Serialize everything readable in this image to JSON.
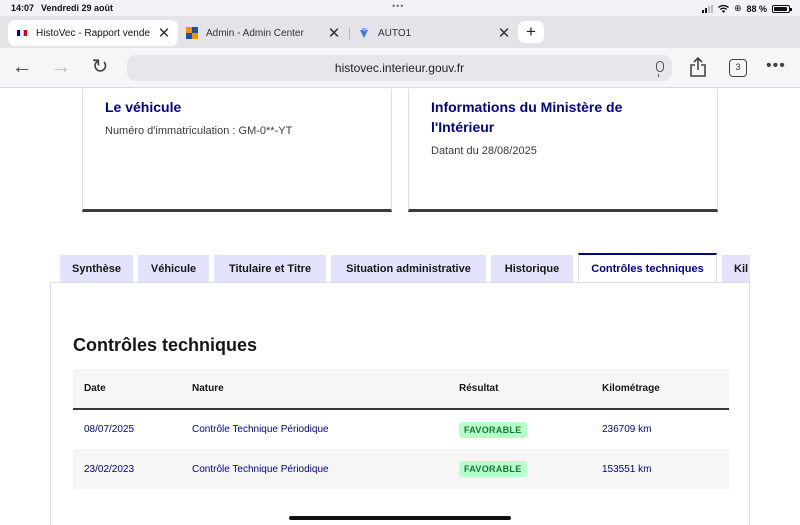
{
  "status_bar": {
    "time": "14:07",
    "date": "Vendredi 29 août",
    "battery": "88 %"
  },
  "browser": {
    "tabs": [
      {
        "title": "HistoVec - Rapport vende",
        "active": true
      },
      {
        "title": "Admin - Admin Center",
        "active": false
      },
      {
        "title": "AUTO1",
        "active": false
      }
    ],
    "url": "histovec.interieur.gouv.fr",
    "tab_count": "3"
  },
  "cards": {
    "vehicle": {
      "title": "Le véhicule",
      "text": "Numéro d'immatriculation : GM-0**-YT"
    },
    "ministry": {
      "title_line1": "Informations du Ministère de",
      "title_line2": "l'Intérieur",
      "text": "Datant du 28/08/2025"
    }
  },
  "nav_tabs": [
    "Synthèse",
    "Véhicule",
    "Titulaire et Titre",
    "Situation administrative",
    "Historique",
    "Contrôles techniques",
    "Kil"
  ],
  "section": {
    "title": "Contrôles techniques",
    "columns": [
      "Date",
      "Nature",
      "Résultat",
      "Kilométrage"
    ],
    "rows": [
      {
        "date": "08/07/2025",
        "nature": "Contrôle Technique Périodique",
        "result": "FAVORABLE",
        "km": "236709 km"
      },
      {
        "date": "23/02/2023",
        "nature": "Contrôle Technique Périodique",
        "result": "FAVORABLE",
        "km": "153551 km"
      }
    ]
  },
  "colors": {
    "accent": "#000091",
    "tab_bg": "#e3e3fd",
    "badge_bg": "#b8fec9",
    "badge_text": "#18753c"
  }
}
